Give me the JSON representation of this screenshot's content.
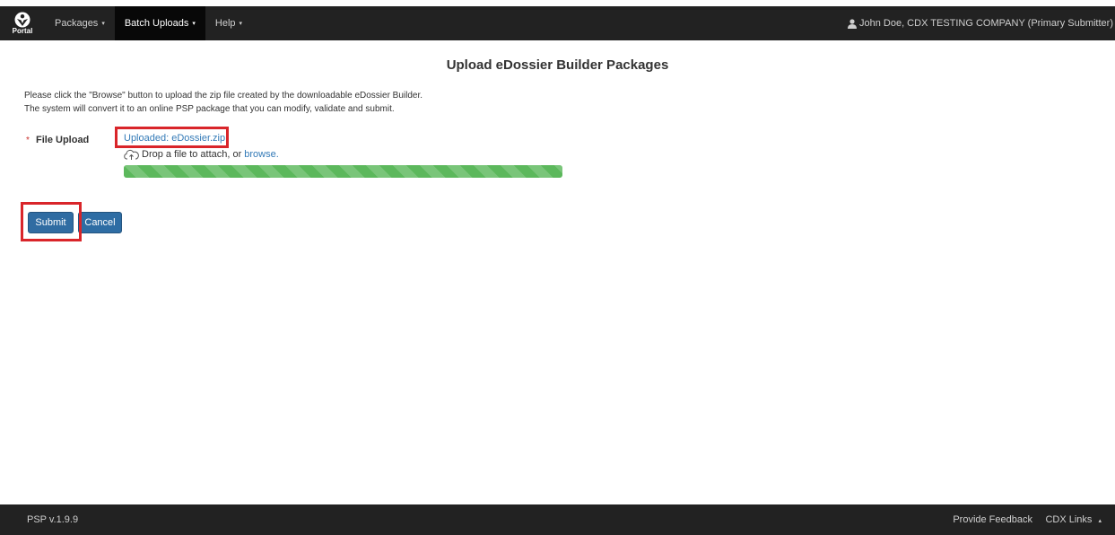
{
  "navbar": {
    "brand_text": "Portal",
    "items": [
      {
        "label": "Packages",
        "caret": "▾"
      },
      {
        "label": "Batch Uploads",
        "caret": "▾"
      },
      {
        "label": "Help",
        "caret": "▾"
      }
    ],
    "user": "John Doe, CDX TESTING COMPANY (Primary Submitter)",
    "user_icon": "user-icon"
  },
  "page": {
    "title": "Upload eDossier Builder Packages",
    "intro_line1": "Please click the \"Browse\" button to upload the zip file created by the downloadable eDossier Builder.",
    "intro_line2": "The system will convert it to an online PSP package that you can modify, validate and submit."
  },
  "upload": {
    "required_marker": "*",
    "label": "File Upload",
    "uploaded_text": "Uploaded: eDossier.zip",
    "drop_text": "Drop a file to attach, or",
    "browse_link": "browse.",
    "progress_percent": 100,
    "icon": "cloud-upload-icon"
  },
  "buttons": {
    "submit": "Submit",
    "cancel": "Cancel"
  },
  "footer": {
    "version": "PSP  v.1.9.9",
    "feedback": "Provide Feedback",
    "cdx_links": "CDX Links",
    "caret": "▴"
  },
  "colors": {
    "navbar": "#222222",
    "primary": "#337ab7",
    "success": "#5cb85c",
    "highlight": "#d9252a"
  }
}
